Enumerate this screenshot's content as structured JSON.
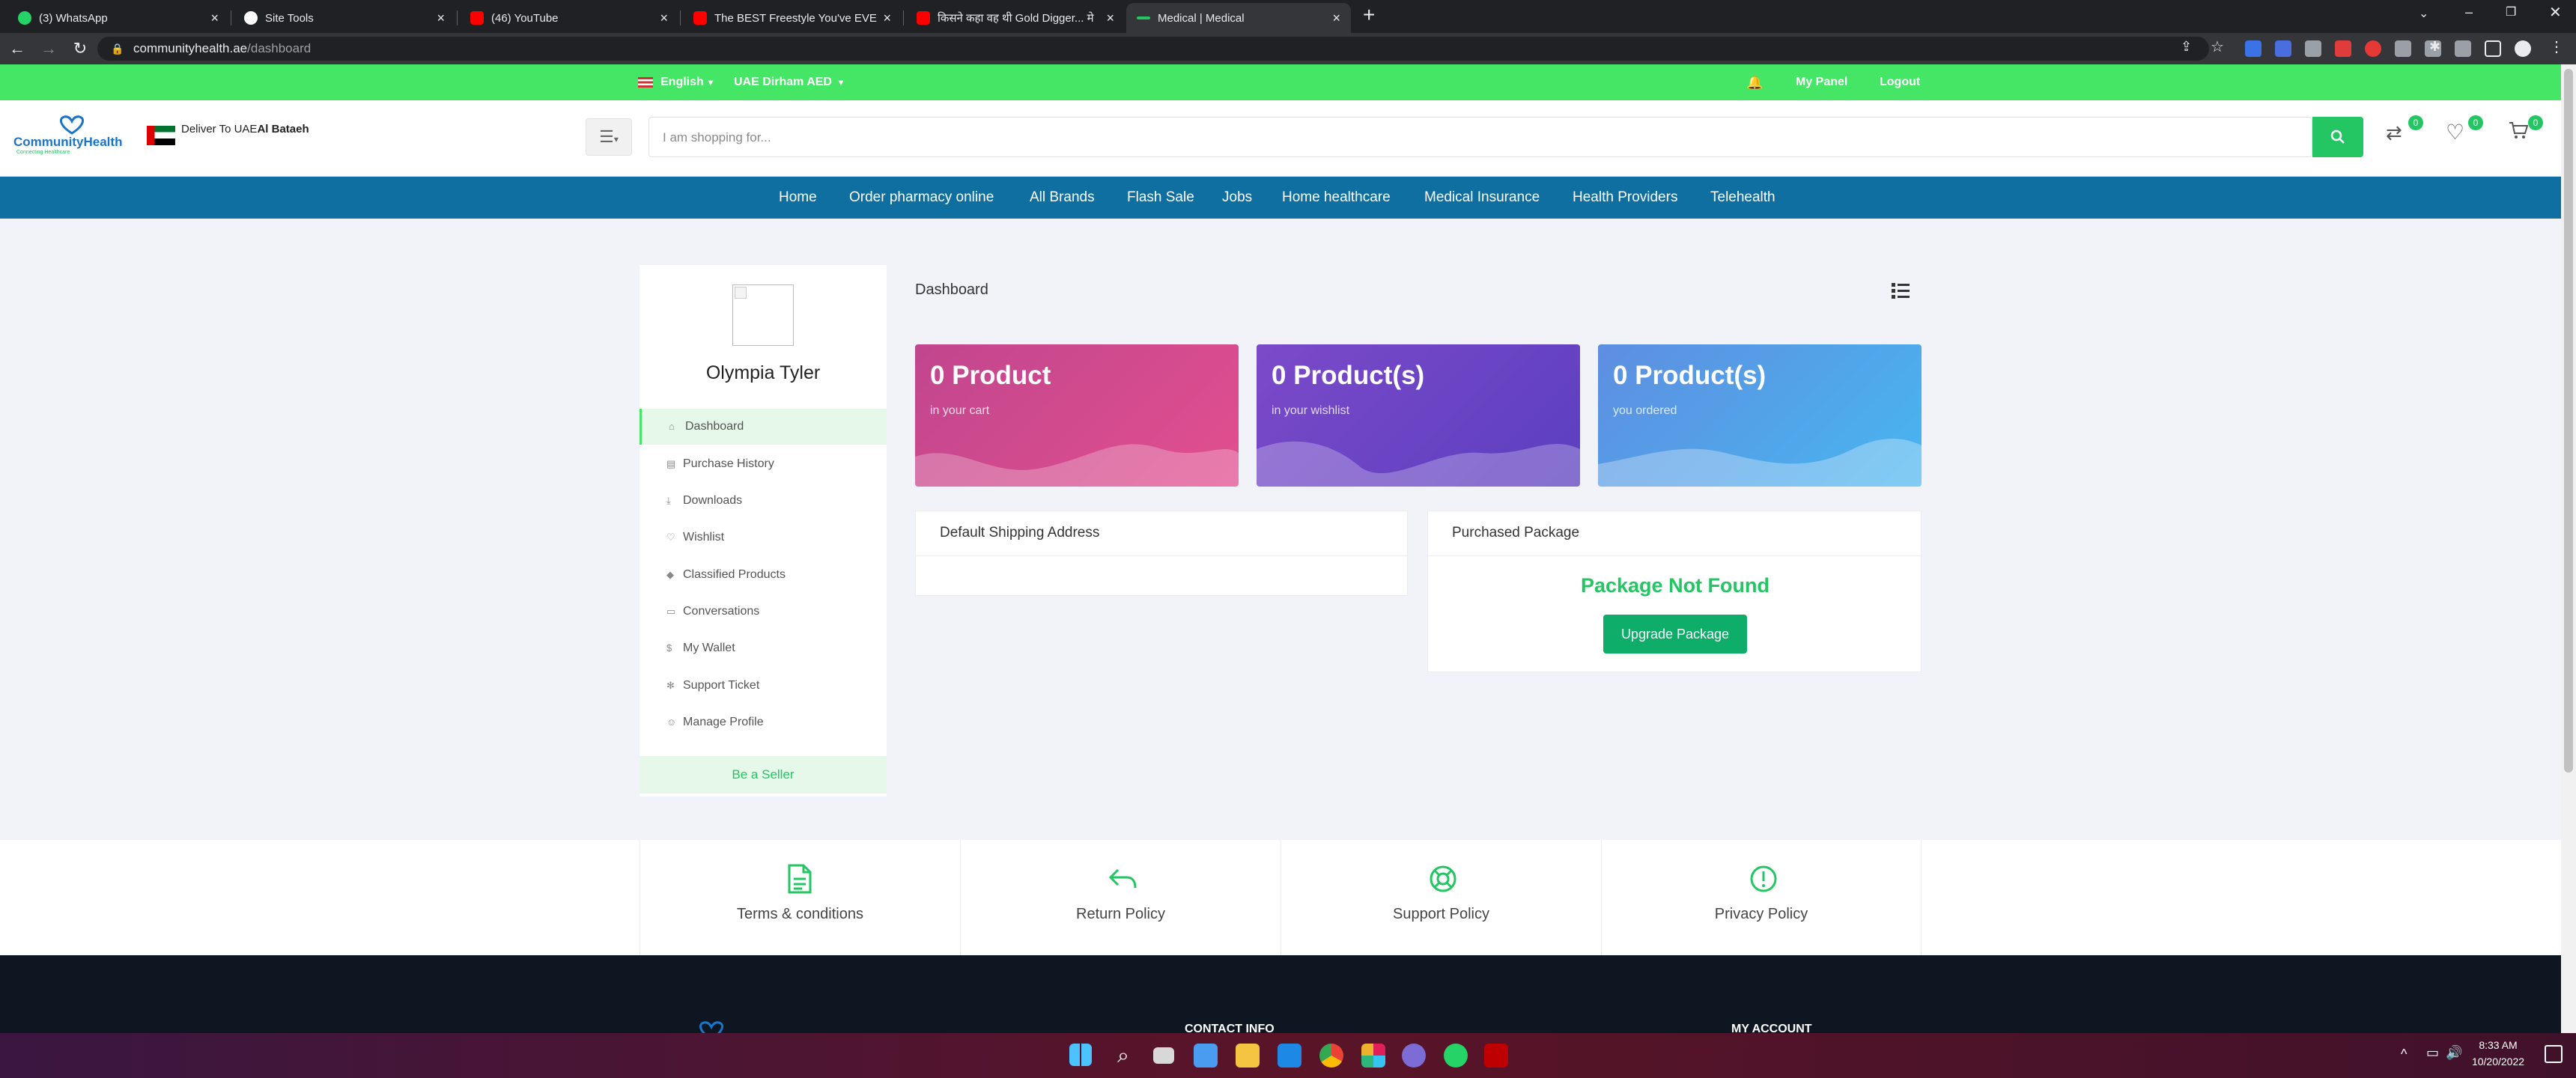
{
  "browser": {
    "tabs": [
      {
        "title": "(3) WhatsApp",
        "color": "#25d366"
      },
      {
        "title": "Site Tools",
        "color": "#ffffff"
      },
      {
        "title": "(46) YouTube",
        "color": "#ff0000"
      },
      {
        "title": "The BEST Freestyle You've EVER S",
        "color": "#ff0000"
      },
      {
        "title": "किसने कहा वह थी Gold Digger... मे",
        "color": "#ff0000"
      },
      {
        "title": "Medical | Medical",
        "color": "#23c663"
      }
    ],
    "url_host": "communityhealth.ae",
    "url_path": "/dashboard"
  },
  "topbar": {
    "language": "English",
    "currency": "UAE Dirham AED",
    "my_panel": "My Panel",
    "logout": "Logout"
  },
  "header": {
    "logo_text": "CommunityHealth",
    "logo_tagline": "Connecting Healthcare",
    "deliver_prefix": "Deliver To UAE",
    "deliver_city": "Al Bataeh",
    "search_placeholder": "I am shopping for...",
    "compare_count": "0",
    "wishlist_count": "0",
    "cart_count": "0"
  },
  "nav": [
    "Home",
    "Order pharmacy online",
    "All Brands",
    "Flash Sale",
    "Jobs",
    "Home healthcare",
    "Medical Insurance",
    "Health Providers",
    "Telehealth"
  ],
  "sidebar": {
    "user_name": "Olympia Tyler",
    "items": [
      {
        "label": "Dashboard",
        "icon": "home-icon"
      },
      {
        "label": "Purchase History",
        "icon": "file-icon"
      },
      {
        "label": "Downloads",
        "icon": "download-icon"
      },
      {
        "label": "Wishlist",
        "icon": "heart-icon"
      },
      {
        "label": "Classified Products",
        "icon": "diamond-icon"
      },
      {
        "label": "Conversations",
        "icon": "chat-icon"
      },
      {
        "label": "My Wallet",
        "icon": "dollar-icon"
      },
      {
        "label": "Support Ticket",
        "icon": "gear-icon"
      },
      {
        "label": "Manage Profile",
        "icon": "user-icon"
      }
    ],
    "be_seller": "Be a Seller"
  },
  "dashboard": {
    "title": "Dashboard",
    "cards": [
      {
        "count": "0 Product",
        "caption": "in your cart",
        "colors": [
          "#d3458f",
          "#e0609e"
        ]
      },
      {
        "count": "0 Product(s)",
        "caption": "in your wishlist",
        "colors": [
          "#6a3fbf",
          "#8a55c9"
        ]
      },
      {
        "count": "0 Product(s)",
        "caption": "you ordered",
        "colors": [
          "#5c87e0",
          "#4fb5ef"
        ]
      }
    ],
    "shipping_title": "Default Shipping Address",
    "package_title": "Purchased Package",
    "package_status": "Package Not Found",
    "upgrade_button": "Upgrade Package"
  },
  "policies": [
    "Terms & conditions",
    "Return Policy",
    "Support Policy",
    "Privacy Policy"
  ],
  "footer": {
    "contact": "CONTACT INFO",
    "account": "MY ACCOUNT"
  },
  "taskbar": {
    "time": "8:33 AM",
    "date": "10/20/2022"
  }
}
